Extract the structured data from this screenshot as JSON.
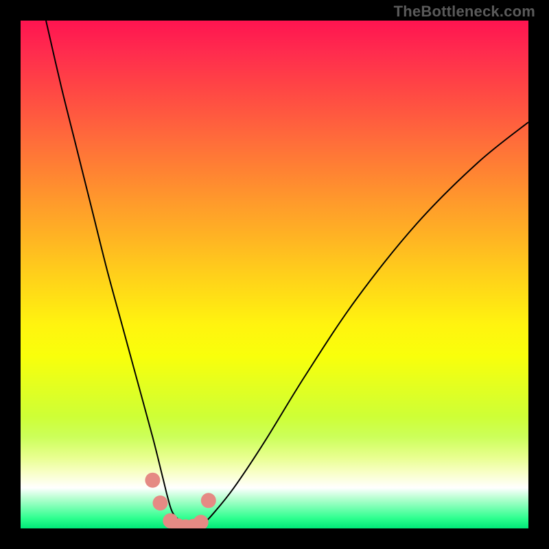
{
  "watermark": "TheBottleneck.com",
  "chart_data": {
    "type": "line",
    "title": "",
    "xlabel": "",
    "ylabel": "",
    "xlim": [
      0,
      100
    ],
    "ylim": [
      0,
      100
    ],
    "grid": false,
    "series": [
      {
        "name": "bottleneck-curve",
        "color": "#000000",
        "x": [
          5,
          8,
          11,
          14,
          17,
          20,
          23,
          26,
          28,
          29,
          30,
          32,
          34,
          36,
          38,
          42,
          48,
          56,
          66,
          78,
          90,
          100
        ],
        "y": [
          100,
          87,
          75,
          63,
          51,
          40,
          29,
          18,
          10,
          6,
          3,
          1,
          0,
          1,
          3,
          8,
          17,
          30,
          45,
          60,
          72,
          80
        ]
      },
      {
        "name": "marker-dots",
        "color": "#e58a84",
        "x": [
          26,
          27.5,
          29.5,
          31,
          32.5,
          34,
          35.5,
          37
        ],
        "y": [
          9.5,
          5,
          1.5,
          0.5,
          0.3,
          0.4,
          1.2,
          5.5
        ]
      }
    ],
    "gradient_bands": [
      {
        "pos": 0.0,
        "color": "#ff1450",
        "meaning": "high-bottleneck"
      },
      {
        "pos": 0.6,
        "color": "#fff40f",
        "meaning": "mid"
      },
      {
        "pos": 0.92,
        "color": "#ffffff",
        "meaning": "near-ideal"
      },
      {
        "pos": 1.0,
        "color": "#00e878",
        "meaning": "ideal"
      }
    ]
  }
}
